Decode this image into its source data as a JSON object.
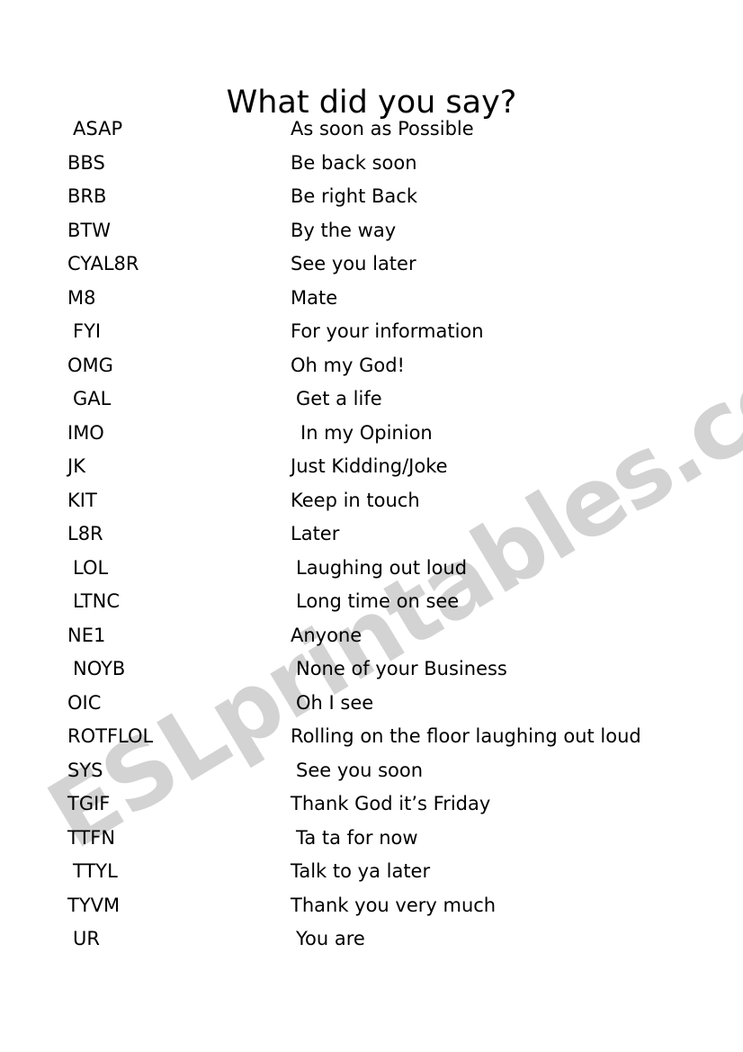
{
  "document": {
    "title": "What did you say?",
    "watermark": "ESLprintables.com",
    "watermark_color": "#d3d3d3",
    "background_color": "#ffffff",
    "text_color": "#000000"
  },
  "columns": {
    "abbreviation_header": "",
    "meaning_header": ""
  },
  "rows": [
    {
      "abbr": "ASAP",
      "abbr_indent": 1,
      "meaning": "As soon as Possible",
      "meaning_indent": 0
    },
    {
      "abbr": "BBS",
      "abbr_indent": 0,
      "meaning": "Be back soon",
      "meaning_indent": 0
    },
    {
      "abbr": "BRB",
      "abbr_indent": 0,
      "meaning": "Be right Back",
      "meaning_indent": 0
    },
    {
      "abbr": "BTW",
      "abbr_indent": 0,
      "meaning": "By the way",
      "meaning_indent": 0
    },
    {
      "abbr": "CYAL8R",
      "abbr_indent": 0,
      "meaning": "See you later",
      "meaning_indent": 0
    },
    {
      "abbr": "M8",
      "abbr_indent": 0,
      "meaning": "Mate",
      "meaning_indent": 0
    },
    {
      "abbr": "FYI",
      "abbr_indent": 1,
      "meaning": "For your information",
      "meaning_indent": 0
    },
    {
      "abbr": "OMG",
      "abbr_indent": 0,
      "meaning": "Oh my God!",
      "meaning_indent": 0
    },
    {
      "abbr": "GAL",
      "abbr_indent": 1,
      "meaning": "Get a life",
      "meaning_indent": 1
    },
    {
      "abbr": "IMO",
      "abbr_indent": 0,
      "meaning": "In my Opinion",
      "meaning_indent": 2
    },
    {
      "abbr": "JK",
      "abbr_indent": 0,
      "meaning": "Just Kidding/Joke",
      "meaning_indent": 0
    },
    {
      "abbr": "KIT",
      "abbr_indent": 0,
      "meaning": "Keep in touch",
      "meaning_indent": 0
    },
    {
      "abbr": "L8R",
      "abbr_indent": 0,
      "meaning": "Later",
      "meaning_indent": 0
    },
    {
      "abbr": "LOL",
      "abbr_indent": 1,
      "meaning": "Laughing out loud",
      "meaning_indent": 1
    },
    {
      "abbr": "LTNC",
      "abbr_indent": 1,
      "meaning": "Long time on see",
      "meaning_indent": 1
    },
    {
      "abbr": "NE1",
      "abbr_indent": 0,
      "meaning": "Anyone",
      "meaning_indent": 0
    },
    {
      "abbr": "NOYB",
      "abbr_indent": 1,
      "meaning": "None of your Business",
      "meaning_indent": 1
    },
    {
      "abbr": "OIC",
      "abbr_indent": 0,
      "meaning": "Oh I see",
      "meaning_indent": 1
    },
    {
      "abbr": "ROTFLOL",
      "abbr_indent": 0,
      "meaning": "Rolling on the floor laughing out loud",
      "meaning_indent": 0
    },
    {
      "abbr": "SYS",
      "abbr_indent": 0,
      "meaning": "See you soon",
      "meaning_indent": 1
    },
    {
      "abbr": "TGIF",
      "abbr_indent": 0,
      "meaning": "Thank God it’s Friday",
      "meaning_indent": 0
    },
    {
      "abbr": "TTFN",
      "abbr_indent": 0,
      "meaning": "Ta ta for now",
      "meaning_indent": 1
    },
    {
      "abbr": "TTYL",
      "abbr_indent": 1,
      "meaning": "Talk to ya later",
      "meaning_indent": 0
    },
    {
      "abbr": "TYVM",
      "abbr_indent": 0,
      "meaning": "Thank you very much",
      "meaning_indent": 0
    },
    {
      "abbr": "UR",
      "abbr_indent": 1,
      "meaning": "You are",
      "meaning_indent": 1
    }
  ]
}
